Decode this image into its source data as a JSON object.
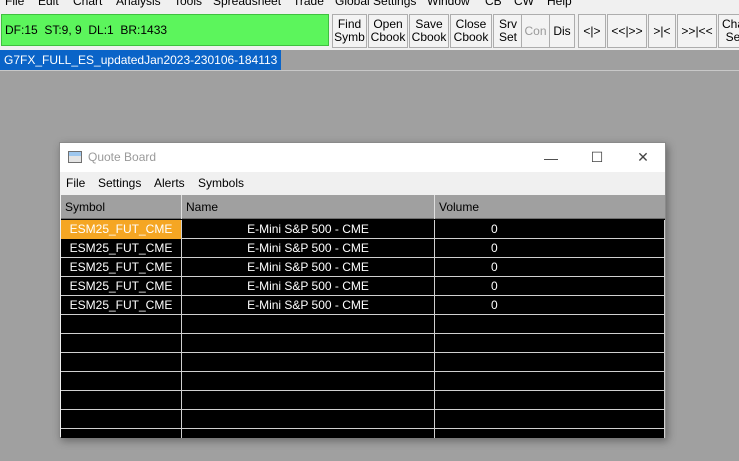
{
  "menubar": {
    "items": [
      "File",
      "Edit",
      "Chart",
      "Analysis",
      "Tools",
      "Spreadsheet",
      "Trade",
      "Global Settings",
      "Window",
      "CB",
      "CW",
      "Help"
    ]
  },
  "toolbar": {
    "status_text": "DF:15  ST:9, 9  DL:1  BR:1433",
    "buttons": [
      {
        "label": "Find\nSymb"
      },
      {
        "label": "Open\nCbook"
      },
      {
        "label": "Save\nCbook"
      },
      {
        "label": "Close\nCbook"
      },
      {
        "label": "Srv\nSet"
      },
      {
        "label": "Con"
      },
      {
        "label": "Dis"
      },
      {
        "label": "<|>"
      },
      {
        "label": "<<|>>"
      },
      {
        "label": ">|<"
      },
      {
        "label": ">>|<<"
      },
      {
        "label": "Cha\nSe"
      }
    ]
  },
  "workspace": {
    "label": "G7FX_FULL_ES_updatedJan2023-230106-184113"
  },
  "quote_board": {
    "title": "Quote Board",
    "controls": {
      "minimize": "—",
      "maximize": "☐",
      "close": "✕"
    },
    "menu": [
      "File",
      "Settings",
      "Alerts",
      "Symbols"
    ],
    "columns": [
      "Symbol",
      "Name",
      "Volume"
    ],
    "rows": [
      {
        "symbol": "ESM25_FUT_CME",
        "name": "E-Mini S&P 500 - CME",
        "volume": "0"
      },
      {
        "symbol": "ESM25_FUT_CME",
        "name": "E-Mini S&P 500 - CME",
        "volume": "0"
      },
      {
        "symbol": "ESM25_FUT_CME",
        "name": "E-Mini S&P 500 - CME",
        "volume": "0"
      },
      {
        "symbol": "ESM25_FUT_CME",
        "name": "E-Mini S&P 500 - CME",
        "volume": "0"
      },
      {
        "symbol": "ESM25_FUT_CME",
        "name": "E-Mini S&P 500 - CME",
        "volume": "0"
      }
    ],
    "colors": {
      "selected_cell": "#f5a623",
      "grid_bg": "#000000",
      "status_green": "#5cf55c"
    }
  }
}
